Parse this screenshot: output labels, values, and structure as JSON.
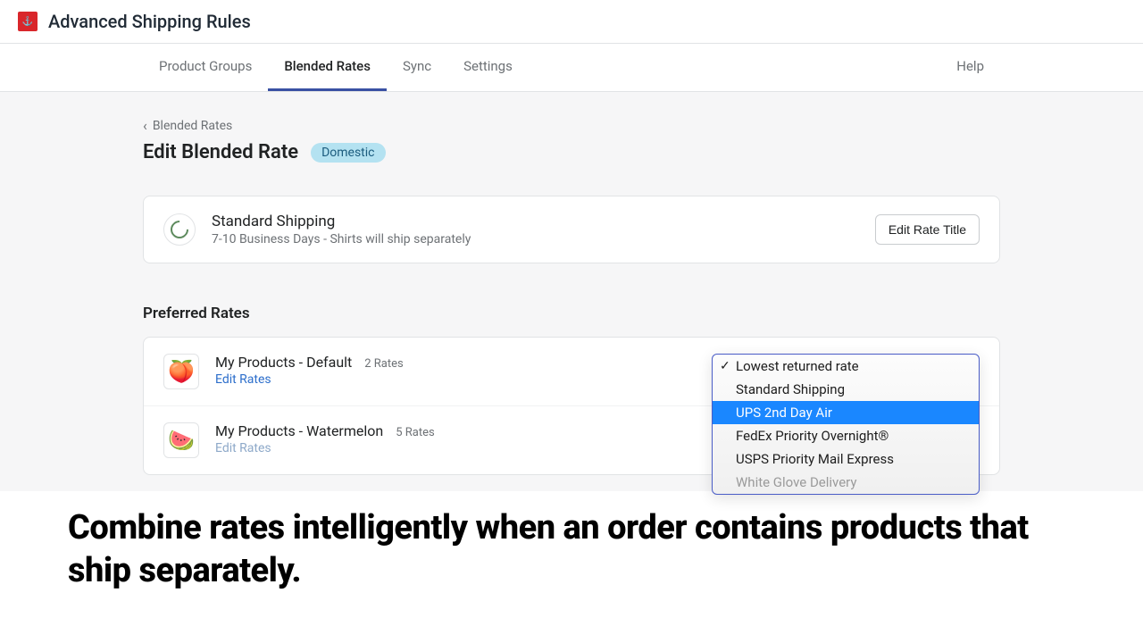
{
  "app": {
    "title": "Advanced Shipping Rules"
  },
  "nav": {
    "items": [
      "Product Groups",
      "Blended Rates",
      "Sync",
      "Settings"
    ],
    "help": "Help"
  },
  "breadcrumb": {
    "label": "Blended Rates"
  },
  "page": {
    "title": "Edit Blended Rate",
    "badge": "Domestic"
  },
  "shipping": {
    "title": "Standard Shipping",
    "subtitle": "7-10 Business Days - Shirts will ship separately",
    "edit_button": "Edit Rate Title"
  },
  "preferred": {
    "heading": "Preferred Rates",
    "rows": [
      {
        "name": "My Products - Default",
        "count": "2 Rates",
        "edit": "Edit Rates",
        "emoji": "🍑"
      },
      {
        "name": "My Products - Watermelon",
        "count": "5 Rates",
        "edit": "Edit Rates",
        "emoji": "🍉"
      }
    ]
  },
  "dropdown": {
    "options": [
      "Lowest returned rate",
      "Standard Shipping",
      "UPS 2nd Day Air",
      "FedEx Priority Overnight®",
      "USPS Priority Mail Express",
      "White Glove Delivery"
    ]
  },
  "headline": "Combine rates intelligently when an order contains products that ship separately."
}
